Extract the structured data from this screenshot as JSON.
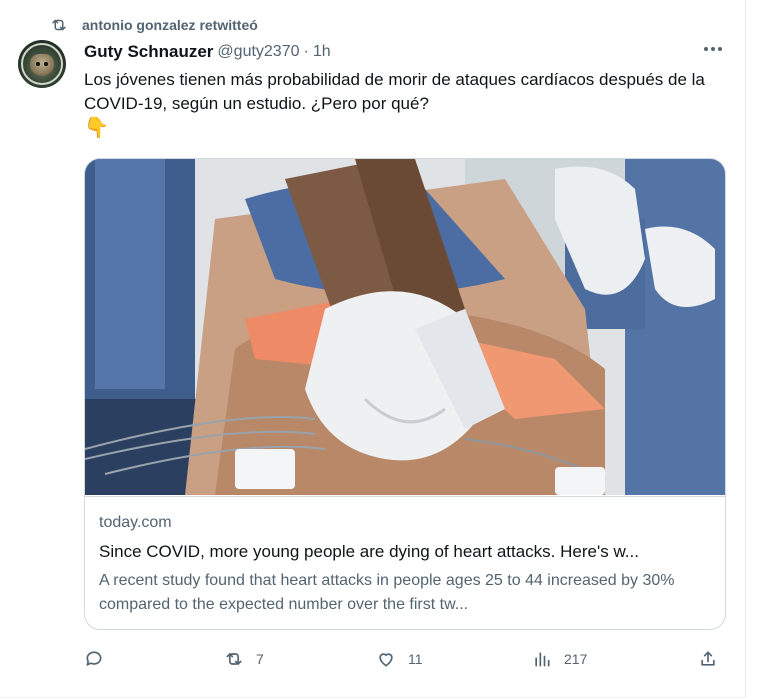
{
  "retweet_banner": {
    "icon": "retweet-icon",
    "text": "antonio gonzalez retwitteó"
  },
  "tweet": {
    "author_name": "Guty Schnauzer",
    "handle": "@guty2370",
    "separator": "·",
    "time": "1h",
    "text": "Los jóvenes tienen más probabilidad de morir de ataques cardíacos después de la COVID-19, según un estudio. ¿Pero por qué?",
    "emoji": "👇"
  },
  "card": {
    "domain": "today.com",
    "title": "Since COVID, more young people are dying of heart attacks. Here's w...",
    "description": "A recent study found that heart attacks in people ages 25 to 44 increased by 30% compared to the expected number over the first tw..."
  },
  "actions": {
    "reply": {
      "icon": "reply-icon",
      "count": ""
    },
    "retweet": {
      "icon": "retweet-icon",
      "count": "7"
    },
    "like": {
      "icon": "heart-icon",
      "count": "11"
    },
    "views": {
      "icon": "analytics-icon",
      "count": "217"
    },
    "share": {
      "icon": "share-icon",
      "count": ""
    }
  },
  "colors": {
    "secondary_text": "#536471",
    "primary_text": "#0f1419",
    "border": "#cfd9de"
  }
}
